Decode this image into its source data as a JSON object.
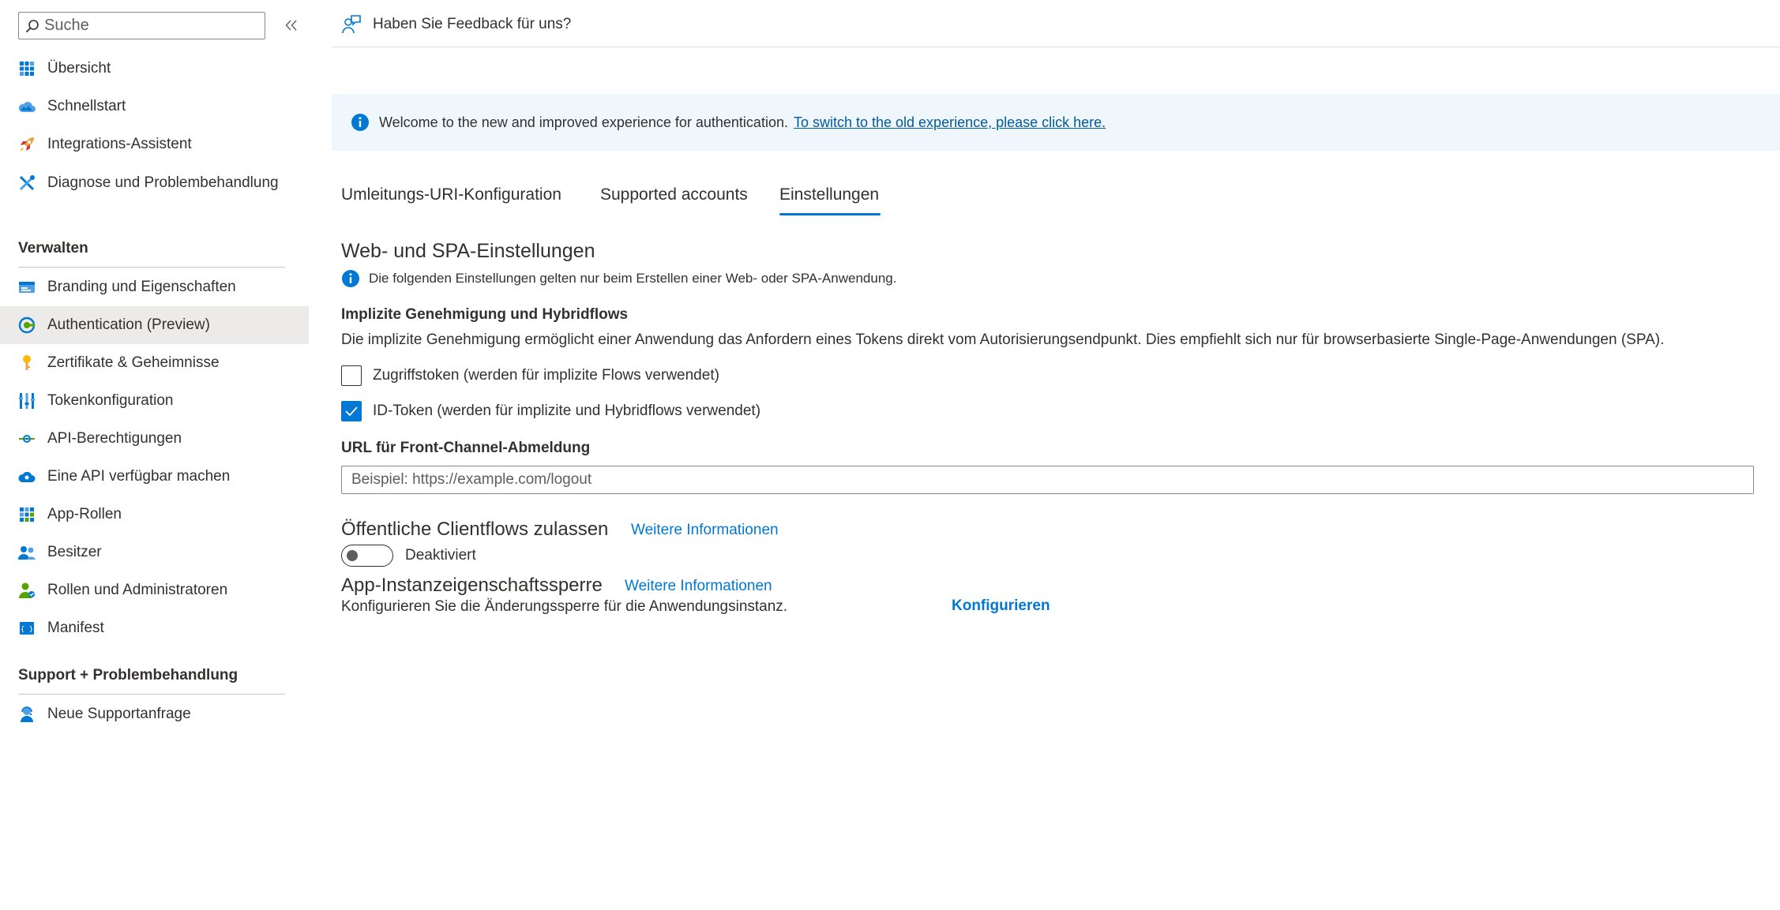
{
  "sidebar": {
    "search": {
      "placeholder": "Suche"
    },
    "items_top": [
      {
        "label": "Übersicht",
        "icon": "overview-grid-icon"
      },
      {
        "label": "Schnellstart",
        "icon": "cloud-quickstart-icon"
      },
      {
        "label": "Integrations-Assistent",
        "icon": "rocket-icon"
      },
      {
        "label": "Diagnose und Problembehandlung",
        "icon": "wrench-tools-icon"
      }
    ],
    "section_manage": "Verwalten",
    "items_manage": [
      {
        "label": "Branding und Eigenschaften",
        "icon": "branding-card-icon"
      },
      {
        "label": "Authentication (Preview)",
        "icon": "authentication-icon",
        "selected": true
      },
      {
        "label": "Zertifikate & Geheimnisse",
        "icon": "key-icon"
      },
      {
        "label": "Tokenkonfiguration",
        "icon": "token-bars-icon"
      },
      {
        "label": "API-Berechtigungen",
        "icon": "api-permissions-icon"
      },
      {
        "label": "Eine API verfügbar machen",
        "icon": "cloud-api-icon"
      },
      {
        "label": "App-Rollen",
        "icon": "app-roles-grid-icon"
      },
      {
        "label": "Besitzer",
        "icon": "owners-people-icon"
      },
      {
        "label": "Rollen und Administratoren",
        "icon": "roles-admin-icon"
      },
      {
        "label": "Manifest",
        "icon": "manifest-icon"
      }
    ],
    "section_support": "Support + Problembehandlung",
    "items_support": [
      {
        "label": "Neue Supportanfrage",
        "icon": "support-person-icon"
      }
    ]
  },
  "header": {
    "feedback": "Haben Sie Feedback für uns?"
  },
  "banner": {
    "text": "Welcome to the new and improved experience for authentication.",
    "link": "To switch to the old experience, please click here."
  },
  "tabs": [
    {
      "label": "Umleitungs-URI-Konfiguration"
    },
    {
      "label": "Supported accounts"
    },
    {
      "label": "Einstellungen",
      "active": true
    }
  ],
  "web_spa": {
    "title": "Web- und SPA-Einstellungen",
    "info": "Die folgenden Einstellungen gelten nur beim Erstellen einer Web- oder SPA-Anwendung.",
    "implicit_heading": "Implizite Genehmigung und Hybridflows",
    "implicit_desc": "Die implizite Genehmigung ermöglicht einer Anwendung das Anfordern eines Tokens direkt vom Autorisierungsendpunkt. Dies empfiehlt sich nur für browserbasierte Single-Page-Anwendungen (SPA).",
    "checkbox_access": {
      "label": "Zugriffstoken (werden für implizite Flows verwendet)",
      "checked": false
    },
    "checkbox_id": {
      "label": "ID-Token (werden für implizite und Hybridflows verwendet)",
      "checked": true
    },
    "logout_label": "URL für Front-Channel-Abmeldung",
    "logout_placeholder": "Beispiel: https://example.com/logout"
  },
  "public_clients": {
    "title": "Öffentliche Clientflows zulassen",
    "more": "Weitere Informationen",
    "toggle_label": "Deaktiviert",
    "enabled": false
  },
  "instance_lock": {
    "title": "App-Instanzeigenschaftssperre",
    "more": "Weitere Informationen",
    "desc": "Konfigurieren Sie die Änderungssperre für die Anwendungsinstanz.",
    "button": "Konfigurieren"
  },
  "colors": {
    "accent": "#0078d4",
    "banner_bg": "#eff6fc",
    "selected_bg": "#edebe9"
  }
}
